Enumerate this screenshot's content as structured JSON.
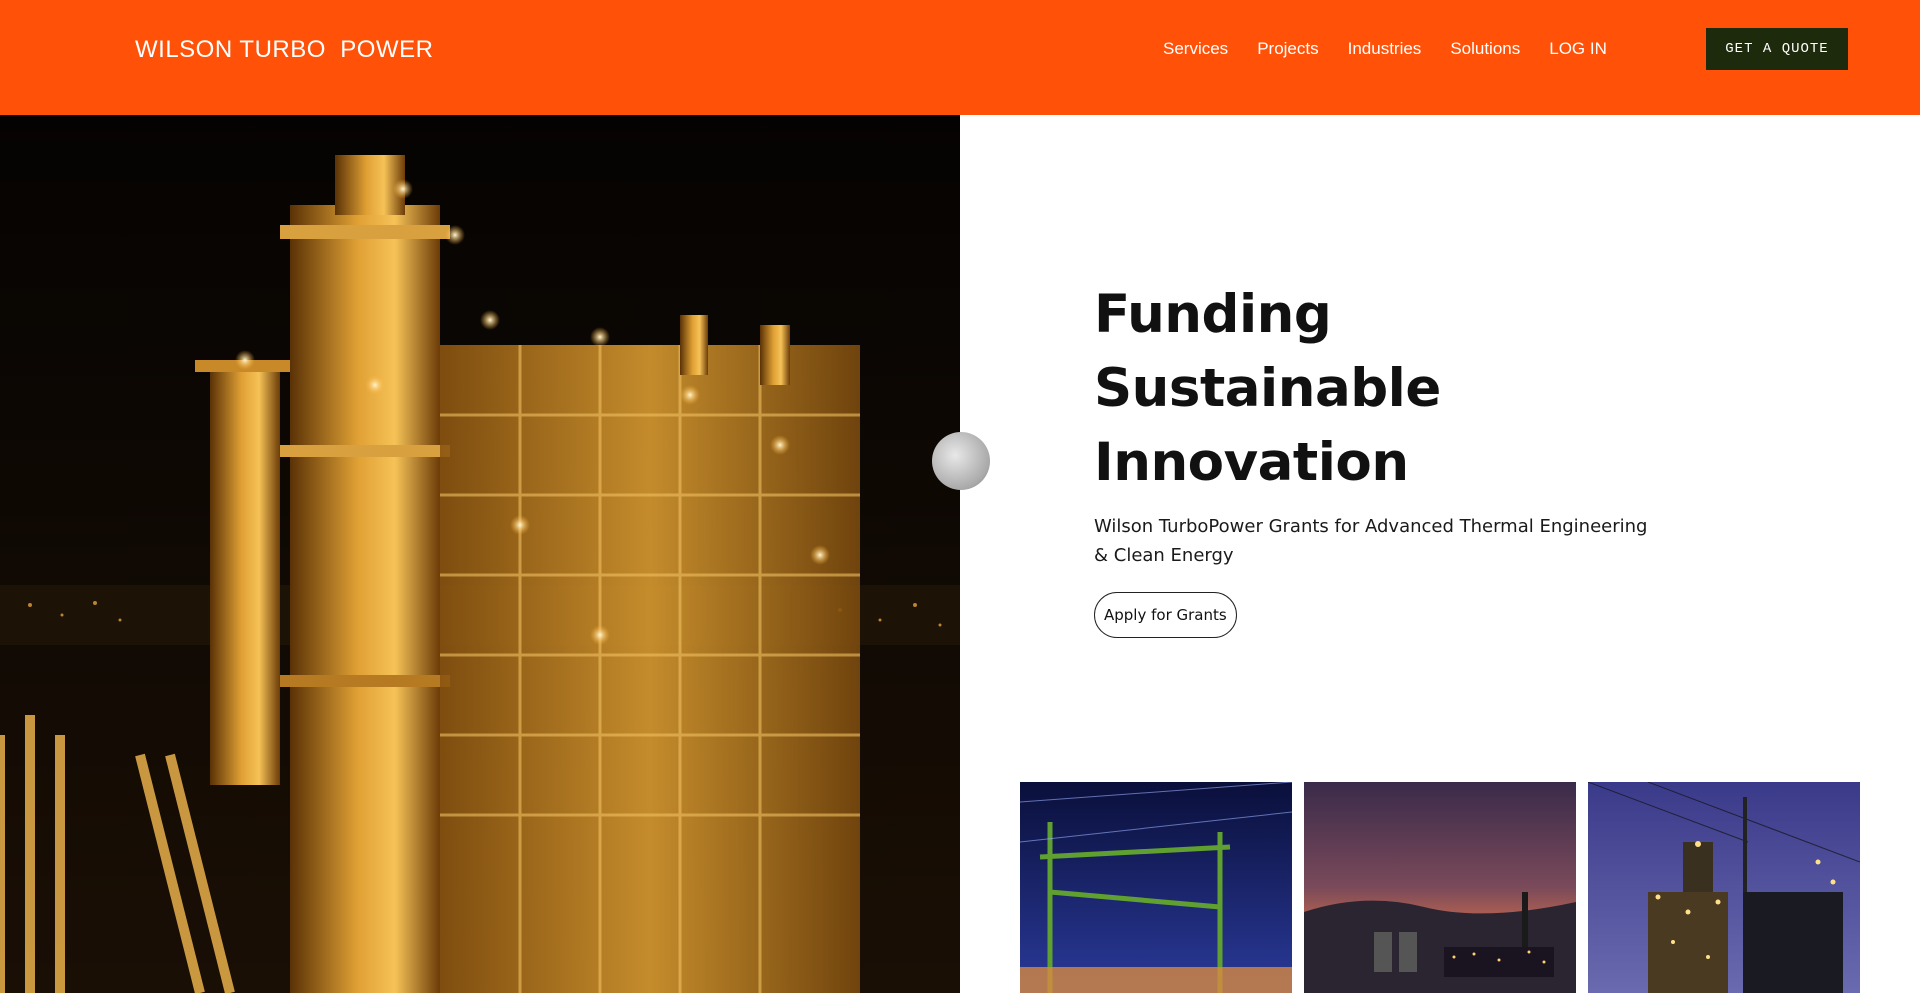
{
  "header": {
    "logo": "WILSON TURBO  POWER",
    "nav": [
      "Services",
      "Projects",
      "Industries",
      "Solutions",
      "LOG IN"
    ],
    "quote_button": "GET A QUOTE"
  },
  "hero": {
    "headline": "Funding Sustainable Innovation",
    "subheadline": "Wilson TurboPower Grants for Advanced Thermal Engineering & Clean Energy",
    "cta": "Apply for Grants"
  },
  "colors": {
    "header_bg": "#FF5208",
    "quote_button_bg": "#1E2A0C",
    "text_dark": "#111111"
  },
  "images": {
    "hero": "power-plant-night-photo",
    "thumbnails": [
      "power-lines-night-photo",
      "plant-at-dusk-photo",
      "lit-refinery-night-photo"
    ]
  }
}
